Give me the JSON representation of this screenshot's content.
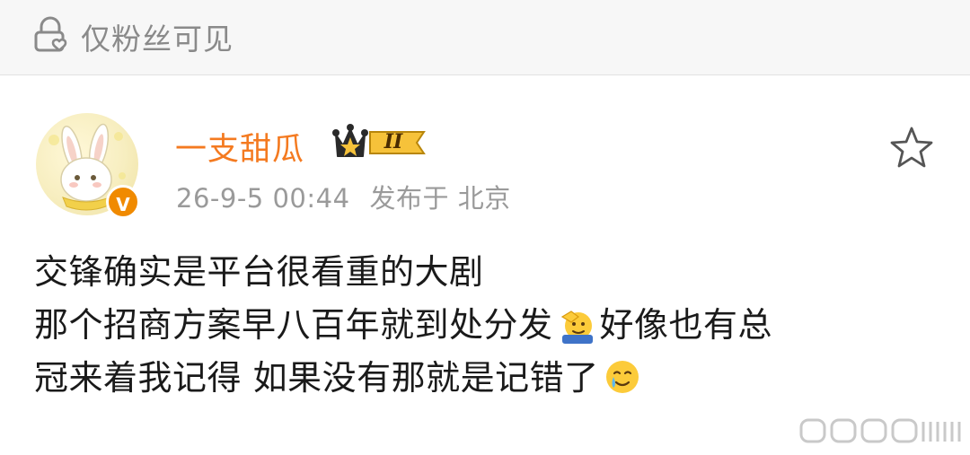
{
  "visibility": {
    "label": "仅粉丝可见",
    "icon": "lock-heart-icon"
  },
  "author": {
    "name": "一支甜瓜",
    "level": "II",
    "verified_badge": "V",
    "name_color": "#f47a20"
  },
  "meta": {
    "time": "26-9-5 00:44",
    "source": "发布于 北京"
  },
  "post": {
    "line1": "交锋确实是平台很看重的大剧",
    "line2_a": "那个招商方案早八百年就到处分发",
    "line2_b": "好像也有总",
    "line3_a": "冠来着我记得 如果没有那就是记错了",
    "emoji1": "saluting-face-emoji",
    "emoji2": "crying-smile-emoji"
  },
  "actions": {
    "favorite_icon": "star-outline-icon"
  },
  "colors": {
    "topbar_bg": "#f7f7f7",
    "meta_text": "#9a9a9a"
  }
}
